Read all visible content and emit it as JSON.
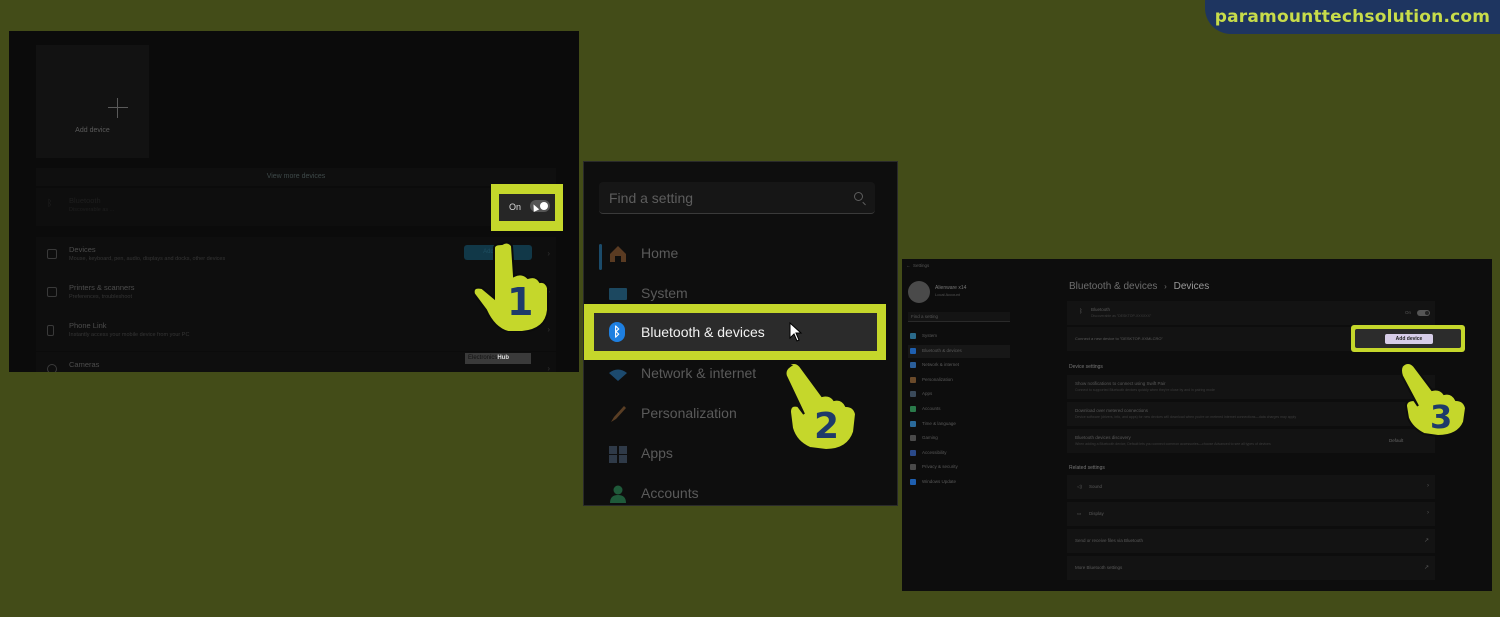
{
  "watermark": {
    "brand": "paramounttechsolution.com"
  },
  "colors": {
    "background": "#434c18",
    "highlight": "#c5d72b",
    "step_number": "#1e3a6a",
    "bluetooth_blue": "#1e7fe0",
    "brand_bg": "#1e3560"
  },
  "step1": {
    "step_number": "1",
    "add_device_tile_label": "Add device",
    "view_more_label": "View more devices",
    "bluetooth": {
      "title": "Bluetooth",
      "subtitle": "Discoverable as ...",
      "toggle_label": "On",
      "toggle_state": "on"
    },
    "rows": [
      {
        "icon": "devices-icon",
        "title": "Devices",
        "subtitle": "Mouse, keyboard, pen, audio, displays and docks, other devices",
        "button": "Add device"
      },
      {
        "icon": "printer-icon",
        "title": "Printers & scanners",
        "subtitle": "Preferences, troubleshoot"
      },
      {
        "icon": "phone-icon",
        "title": "Phone Link",
        "subtitle": "Instantly access your mobile device from your PC"
      },
      {
        "icon": "camera-icon",
        "title": "Cameras",
        "subtitle": ""
      }
    ],
    "credit": {
      "prefix": "Electronics",
      "suffix": "Hub"
    }
  },
  "step2": {
    "step_number": "2",
    "search_placeholder": "Find a setting",
    "nav": [
      {
        "icon": "home-icon",
        "label": "Home"
      },
      {
        "icon": "system-icon",
        "label": "System"
      },
      {
        "icon": "bluetooth-icon",
        "label": "Bluetooth & devices",
        "highlighted": true
      },
      {
        "icon": "network-icon",
        "label": "Network & internet"
      },
      {
        "icon": "personalization-icon",
        "label": "Personalization"
      },
      {
        "icon": "apps-icon",
        "label": "Apps"
      },
      {
        "icon": "accounts-icon",
        "label": "Accounts"
      }
    ]
  },
  "step3": {
    "step_number": "3",
    "window_title": "Settings",
    "user": {
      "name": "Alienware x14",
      "account": "Local Account"
    },
    "search_placeholder": "Find a setting",
    "nav": [
      {
        "label": "System",
        "color": "#2a6a8a"
      },
      {
        "label": "Bluetooth & devices",
        "color": "#1e5fb0",
        "active": true
      },
      {
        "label": "Network & internet",
        "color": "#2a5e9a"
      },
      {
        "label": "Personalization",
        "color": "#6a4a2a"
      },
      {
        "label": "Apps",
        "color": "#3a4a5a"
      },
      {
        "label": "Accounts",
        "color": "#2a7a4a"
      },
      {
        "label": "Time & language",
        "color": "#2a6a9a"
      },
      {
        "label": "Gaming",
        "color": "#4a4a4a"
      },
      {
        "label": "Accessibility",
        "color": "#2a4a8a"
      },
      {
        "label": "Privacy & security",
        "color": "#4a4a4a"
      },
      {
        "label": "Windows Update",
        "color": "#1e5fb0"
      }
    ],
    "breadcrumb": {
      "parent": "Bluetooth & devices",
      "separator": "›",
      "current": "Devices"
    },
    "bluetooth": {
      "title": "Bluetooth",
      "subtitle": "Discoverable as \"DESKTOP-XXXXXX\"",
      "toggle_label": "On"
    },
    "connect": {
      "label": "Connect a new device to \"DESKTOP-XXMLCRO\"",
      "button": "Add device"
    },
    "device_settings": {
      "heading": "Device settings",
      "items": [
        {
          "title": "Show notifications to connect using Swift Pair",
          "subtitle": "Connect to supported Bluetooth devices quickly when they're close by and in pairing mode"
        },
        {
          "title": "Download over metered connections",
          "subtitle": "Device software (drivers, info, and apps) for new devices will download when you're on metered internet connections—data charges may apply"
        },
        {
          "title": "Bluetooth devices discovery",
          "subtitle": "When adding a Bluetooth device, Default lets you connect common accessories—choose Advanced to see all types of devices",
          "value": "Default"
        }
      ]
    },
    "related_settings": {
      "heading": "Related settings",
      "items": [
        {
          "icon": "sound-icon",
          "label": "Sound",
          "kind": "chevron"
        },
        {
          "icon": "display-icon",
          "label": "Display",
          "kind": "chevron"
        },
        {
          "label": "Send or receive files via Bluetooth",
          "kind": "external"
        },
        {
          "label": "More Bluetooth settings",
          "kind": "external"
        }
      ]
    }
  }
}
